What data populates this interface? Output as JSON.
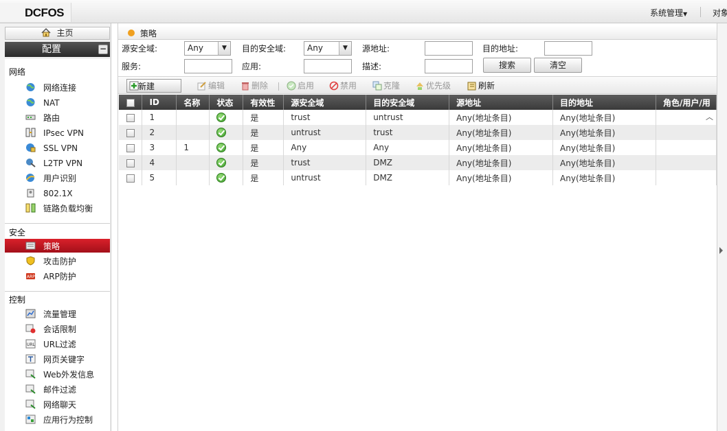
{
  "header": {
    "logo": "DCFOS",
    "system_menu": "系统管理",
    "object_menu": "对象"
  },
  "sidebar": {
    "home": "主页",
    "config": "配置",
    "sections": [
      {
        "title": "网络",
        "items": [
          {
            "label": "网络连接",
            "icon": "globe-icon"
          },
          {
            "label": "NAT",
            "icon": "globe-icon"
          },
          {
            "label": "路由",
            "icon": "router-icon"
          },
          {
            "label": "IPsec VPN",
            "icon": "vpn-icon"
          },
          {
            "label": "SSL VPN",
            "icon": "ssl-vpn-icon"
          },
          {
            "label": "L2TP VPN",
            "icon": "l2tp-vpn-icon"
          },
          {
            "label": "用户识别",
            "icon": "user-id-icon"
          },
          {
            "label": "802.1X",
            "icon": "auth-icon"
          },
          {
            "label": "链路负载均衡",
            "icon": "load-balance-icon"
          }
        ]
      },
      {
        "title": "安全",
        "items": [
          {
            "label": "策略",
            "icon": "policy-icon"
          },
          {
            "label": "攻击防护",
            "icon": "shield-icon"
          },
          {
            "label": "ARP防护",
            "icon": "arp-icon"
          }
        ]
      },
      {
        "title": "控制",
        "items": [
          {
            "label": "流量管理",
            "icon": "traffic-icon"
          },
          {
            "label": "会话限制",
            "icon": "session-limit-icon"
          },
          {
            "label": "URL过滤",
            "icon": "url-filter-icon"
          },
          {
            "label": "网页关键字",
            "icon": "keyword-icon"
          },
          {
            "label": "Web外发信息",
            "icon": "web-outbound-icon"
          },
          {
            "label": "邮件过滤",
            "icon": "mail-filter-icon"
          },
          {
            "label": "网络聊天",
            "icon": "chat-icon"
          },
          {
            "label": "应用行为控制",
            "icon": "app-control-icon"
          }
        ]
      }
    ]
  },
  "breadcrumb": "策略",
  "filter": {
    "src_zone_label": "源安全域:",
    "src_zone_value": "Any",
    "dst_zone_label": "目的安全域:",
    "dst_zone_value": "Any",
    "src_addr_label": "源地址:",
    "dst_addr_label": "目的地址:",
    "service_label": "服务:",
    "app_label": "应用:",
    "desc_label": "描述:",
    "search_btn": "搜索",
    "clear_btn": "清空"
  },
  "toolbar": {
    "new": "新建",
    "edit": "编辑",
    "delete": "删除",
    "enable": "启用",
    "disable": "禁用",
    "clone": "克隆",
    "priority": "优先级",
    "refresh": "刷新"
  },
  "table": {
    "columns": [
      "ID",
      "名称",
      "状态",
      "有效性",
      "源安全域",
      "目的安全域",
      "源地址",
      "目的地址",
      "角色/用户/用"
    ],
    "rows": [
      {
        "id": "1",
        "name": "",
        "valid": "是",
        "src_zone": "trust",
        "dst_zone": "untrust",
        "src_addr": "Any(地址条目)",
        "dst_addr": "Any(地址条目)"
      },
      {
        "id": "2",
        "name": "",
        "valid": "是",
        "src_zone": "untrust",
        "dst_zone": "trust",
        "src_addr": "Any(地址条目)",
        "dst_addr": "Any(地址条目)"
      },
      {
        "id": "3",
        "name": "1",
        "valid": "是",
        "src_zone": "Any",
        "dst_zone": "Any",
        "src_addr": "Any(地址条目)",
        "dst_addr": "Any(地址条目)"
      },
      {
        "id": "4",
        "name": "",
        "valid": "是",
        "src_zone": "trust",
        "dst_zone": "DMZ",
        "src_addr": "Any(地址条目)",
        "dst_addr": "Any(地址条目)"
      },
      {
        "id": "5",
        "name": "",
        "valid": "是",
        "src_zone": "untrust",
        "dst_zone": "DMZ",
        "src_addr": "Any(地址条目)",
        "dst_addr": "Any(地址条目)"
      }
    ]
  }
}
